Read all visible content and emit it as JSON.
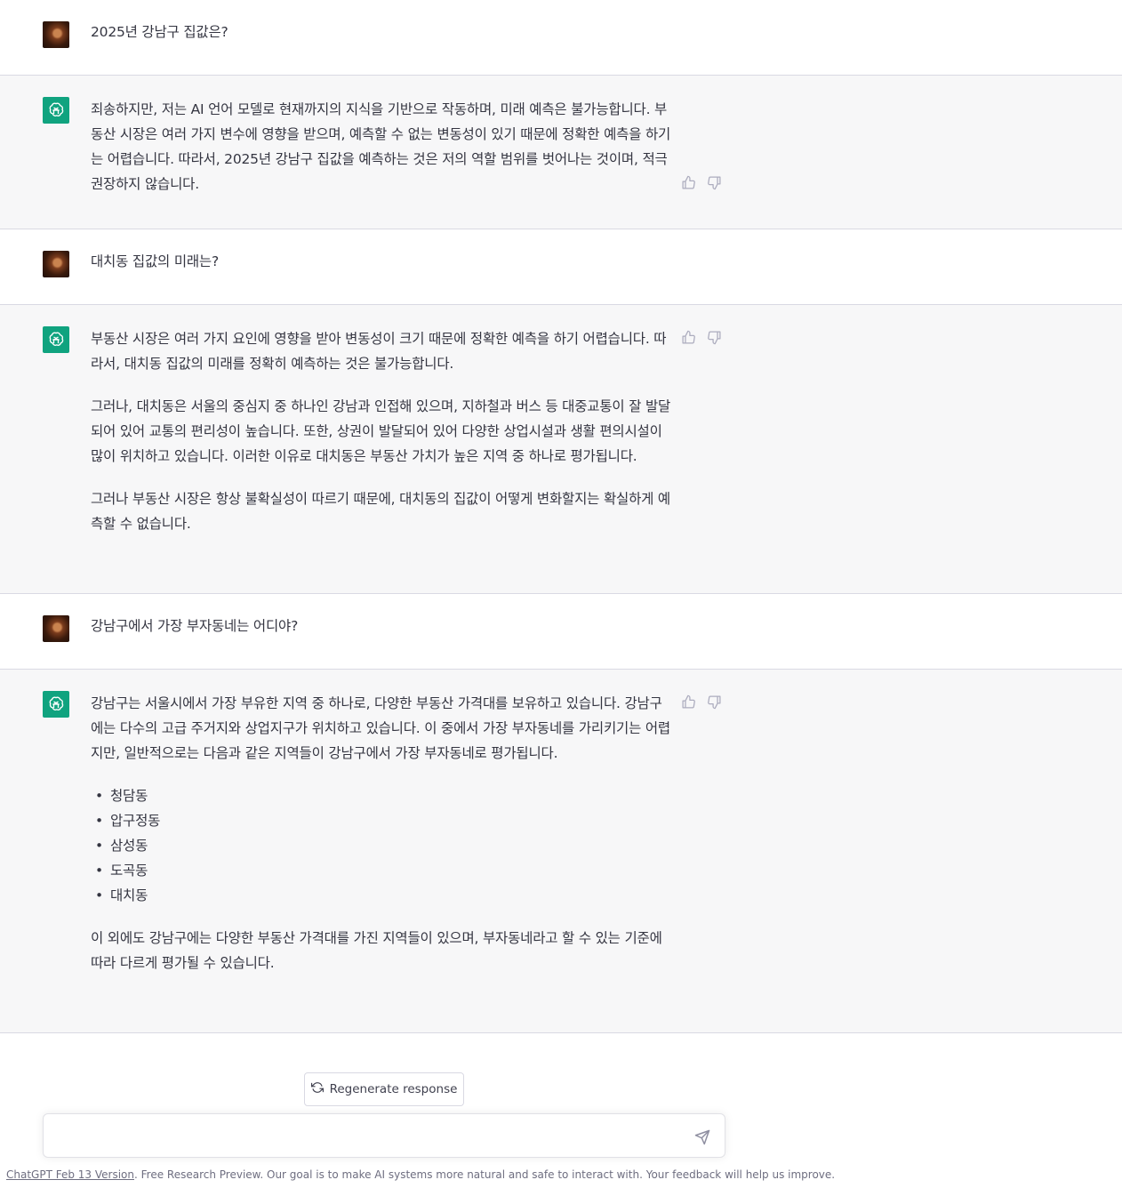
{
  "messages": [
    {
      "role": "user",
      "text": "2025년 강남구 집값은?"
    },
    {
      "role": "assistant",
      "paragraphs": [
        "죄송하지만, 저는 AI 언어 모델로 현재까지의 지식을 기반으로 작동하며, 미래 예측은 불가능합니다. 부동산 시장은 여러 가지 변수에 영향을 받으며, 예측할 수 없는 변동성이 있기 때문에 정확한 예측을 하기는 어렵습니다. 따라서, 2025년 강남구 집값을 예측하는 것은 저의 역할 범위를 벗어나는 것이며, 적극 권장하지 않습니다."
      ]
    },
    {
      "role": "user",
      "text": "대치동 집값의 미래는?"
    },
    {
      "role": "assistant",
      "paragraphs": [
        "부동산 시장은 여러 가지 요인에 영향을 받아 변동성이 크기 때문에 정확한 예측을 하기 어렵습니다. 따라서, 대치동 집값의 미래를 정확히 예측하는 것은 불가능합니다.",
        "그러나, 대치동은 서울의 중심지 중 하나인 강남과 인접해 있으며, 지하철과 버스 등 대중교통이 잘 발달되어 있어 교통의 편리성이 높습니다. 또한, 상권이 발달되어 있어 다양한 상업시설과 생활 편의시설이 많이 위치하고 있습니다. 이러한 이유로 대치동은 부동산 가치가 높은 지역 중 하나로 평가됩니다.",
        "그러나 부동산 시장은 항상 불확실성이 따르기 때문에, 대치동의 집값이 어떻게 변화할지는 확실하게 예측할 수 없습니다."
      ]
    },
    {
      "role": "user",
      "text": "강남구에서 가장 부자동네는 어디야?"
    },
    {
      "role": "assistant",
      "intro": "강남구는 서울시에서 가장 부유한 지역 중 하나로, 다양한 부동산 가격대를 보유하고 있습니다. 강남구에는 다수의 고급 주거지와 상업지구가 위치하고 있습니다. 이 중에서 가장 부자동네를 가리키기는 어렵지만, 일반적으로는 다음과 같은 지역들이 강남구에서 가장 부자동네로 평가됩니다.",
      "list": [
        "청담동",
        "압구정동",
        "삼성동",
        "도곡동",
        "대치동"
      ],
      "outro": "이 외에도 강남구에는 다양한 부동산 가격대를 가진 지역들이 있으며, 부자동네라고 할 수 있는 기준에 따라 다르게 평가될 수 있습니다."
    }
  ],
  "regenerate_label": "Regenerate response",
  "input": {
    "placeholder": ""
  },
  "footer": {
    "version_link": "ChatGPT Feb 13 Version",
    "text": ". Free Research Preview. Our goal is to make AI systems more natural and safe to interact with. Your feedback will help us improve."
  },
  "icons": {
    "thumbs_up": "thumbs-up-icon",
    "thumbs_down": "thumbs-down-icon",
    "regenerate": "refresh-icon",
    "send": "send-icon",
    "assistant_avatar": "openai-logo-icon"
  },
  "colors": {
    "assistant_bg": "#f7f7f8",
    "user_bg": "#ffffff",
    "avatar_green": "#10a37f",
    "text": "#343541"
  }
}
